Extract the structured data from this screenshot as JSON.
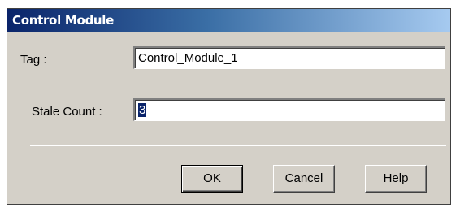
{
  "dialog": {
    "title": "Control Module",
    "tag_label": "Tag :",
    "tag_value": "Control_Module_1",
    "stale_label": "Stale Count :",
    "stale_value": "3",
    "buttons": {
      "ok": "OK",
      "cancel": "Cancel",
      "help": "Help"
    }
  },
  "colors": {
    "title_start": "#0a246a",
    "title_end": "#a6caf0",
    "face": "#d4d0c8",
    "selection": "#0a246a"
  }
}
